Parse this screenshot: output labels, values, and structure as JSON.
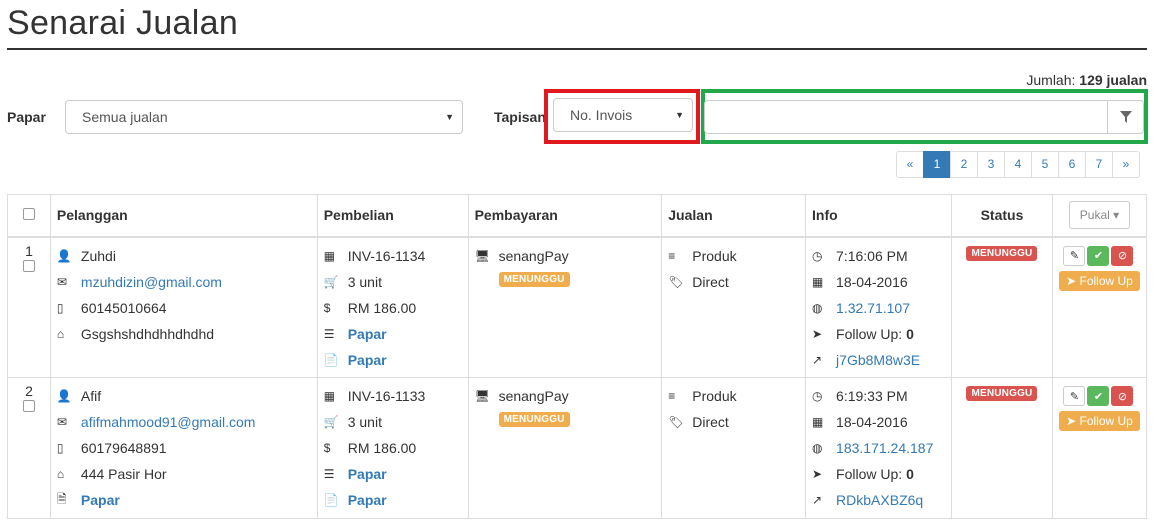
{
  "title": "Senarai Jualan",
  "jumlah": {
    "label": "Jumlah:",
    "value": "129 jualan"
  },
  "papar": {
    "label": "Papar",
    "selected": "Semua jualan"
  },
  "tapisan": {
    "label": "Tapisan",
    "selected": "No. Invois",
    "input_value": ""
  },
  "pagination": [
    "«",
    "1",
    "2",
    "3",
    "4",
    "5",
    "6",
    "7",
    "»"
  ],
  "pagination_active": "1",
  "columns": {
    "pelanggan": "Pelanggan",
    "pembelian": "Pembelian",
    "pembayaran": "Pembayaran",
    "jualan": "Jualan",
    "info": "Info",
    "status": "Status",
    "pukal": "Pukal"
  },
  "rows": [
    {
      "no": "1",
      "name": "Zuhdi",
      "email": "mzuhdizin@gmail.com",
      "phone": "60145010664",
      "address": "Gsgshshdhdhhdhdhd",
      "extra_link": "",
      "invoice": "INV-16-1134",
      "units": "3 unit",
      "amount": "RM 186.00",
      "papar1": "Papar",
      "papar2": "Papar",
      "payment_method": "senangPay",
      "payment_status": "MENUNGGU",
      "jualan_type": "Produk",
      "jualan_channel": "Direct",
      "time": "7:16:06 PM",
      "date": "18-04-2016",
      "ip": "1.32.71.107",
      "followup_label": "Follow Up:",
      "followup_count": "0",
      "code": "j7Gb8M8w3E",
      "status": "MENUNGGU",
      "follow_btn": "Follow Up"
    },
    {
      "no": "2",
      "name": "Afif",
      "email": "afifmahmood91@gmail.com",
      "phone": "60179648891",
      "address": "444 Pasir Hor",
      "extra_link": "Papar",
      "invoice": "INV-16-1133",
      "units": "3 unit",
      "amount": "RM 186.00",
      "papar1": "Papar",
      "papar2": "Papar",
      "payment_method": "senangPay",
      "payment_status": "MENUNGGU",
      "jualan_type": "Produk",
      "jualan_channel": "Direct",
      "time": "6:19:33 PM",
      "date": "18-04-2016",
      "ip": "183.171.24.187",
      "followup_label": "Follow Up:",
      "followup_count": "0",
      "code": "RDkbAXBZ6q",
      "status": "MENUNGGU",
      "follow_btn": "Follow Up"
    }
  ],
  "colors": {
    "primary": "#337ab7",
    "warning": "#f0ad4e",
    "danger": "#d9534f",
    "success": "#5cb85c",
    "highlight_red": "#e0191f",
    "highlight_green": "#22a74a"
  }
}
